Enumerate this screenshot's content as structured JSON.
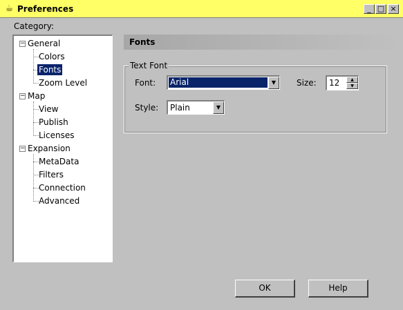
{
  "window": {
    "title": "Preferences",
    "icon": "java-cup-icon",
    "controls": {
      "minimize": "_",
      "maximize": "□",
      "close": "×"
    }
  },
  "category_label": "Category:",
  "tree": {
    "groups": [
      {
        "label": "General",
        "expander": "−",
        "children": [
          "Colors",
          "Fonts",
          "Zoom Level"
        ]
      },
      {
        "label": "Map",
        "expander": "−",
        "children": [
          "View",
          "Publish",
          "Licenses"
        ]
      },
      {
        "label": "Expansion",
        "expander": "−",
        "children": [
          "MetaData",
          "Filters",
          "Connection",
          "Advanced"
        ]
      }
    ],
    "selected": "Fonts"
  },
  "panel": {
    "header": "Fonts",
    "group_title": "Text Font",
    "font_label": "Font:",
    "font_value": "Arial",
    "size_label": "Size:",
    "size_value": "12",
    "style_label": "Style:",
    "style_value": "Plain"
  },
  "buttons": {
    "ok": "OK",
    "help": "Help"
  },
  "colors": {
    "title_bar": "#ffff66",
    "selection": "#0a246a",
    "window_bg": "#c0c0c0"
  }
}
